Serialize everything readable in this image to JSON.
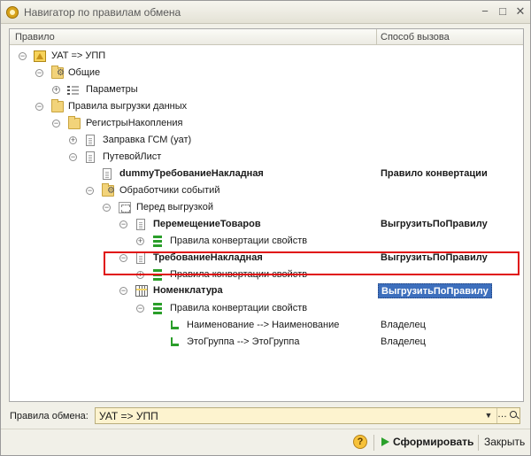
{
  "window": {
    "title": "Навигатор по правилам обмена"
  },
  "columns": {
    "rule": "Правило",
    "call_method": "Способ вызова"
  },
  "tree": [
    {
      "label": "УАТ => УПП",
      "value": "",
      "bold": false
    },
    {
      "label": "Общие",
      "value": "",
      "bold": false
    },
    {
      "label": "Параметры",
      "value": "",
      "bold": false
    },
    {
      "label": "Правила выгрузки данных",
      "value": "",
      "bold": false
    },
    {
      "label": "РегистрыНакопления",
      "value": "",
      "bold": false
    },
    {
      "label": "Заправка ГСМ (уат)",
      "value": "",
      "bold": false
    },
    {
      "label": "ПутевойЛист",
      "value": "",
      "bold": false
    },
    {
      "label": "dummyТребованиеНакладная",
      "value": "Правило конвертации",
      "bold": true
    },
    {
      "label": "Обработчики событий",
      "value": "",
      "bold": false
    },
    {
      "label": "Перед выгрузкой",
      "value": "",
      "bold": false
    },
    {
      "label": "ПеремещениеТоваров",
      "value": "ВыгрузитьПоПравилу",
      "bold": true
    },
    {
      "label": "Правила конвертации свойств",
      "value": "",
      "bold": false
    },
    {
      "label": "ТребованиеНакладная",
      "value": "ВыгрузитьПоПравилу",
      "bold": true
    },
    {
      "label": "Правила конвертации свойств",
      "value": "",
      "bold": false
    },
    {
      "label": "Номенклатура",
      "value": "ВыгрузитьПоПравилу",
      "bold": true,
      "selected": true
    },
    {
      "label": "Правила конвертации свойств",
      "value": "",
      "bold": false
    },
    {
      "label": "Наименование --> Наименование",
      "value": "Владелец",
      "bold": false
    },
    {
      "label": "ЭтоГруппа --> ЭтоГруппа",
      "value": "Владелец",
      "bold": false
    }
  ],
  "exchange_rules": {
    "label": "Правила обмена:",
    "value": "УАТ => УПП"
  },
  "footer": {
    "help_label": "?",
    "run_label": "Сформировать",
    "close_label": "Закрыть"
  },
  "colors": {
    "selection": "#3d6fbd",
    "highlight_box": "#e01010",
    "combo_background": "#fdf3cf"
  }
}
